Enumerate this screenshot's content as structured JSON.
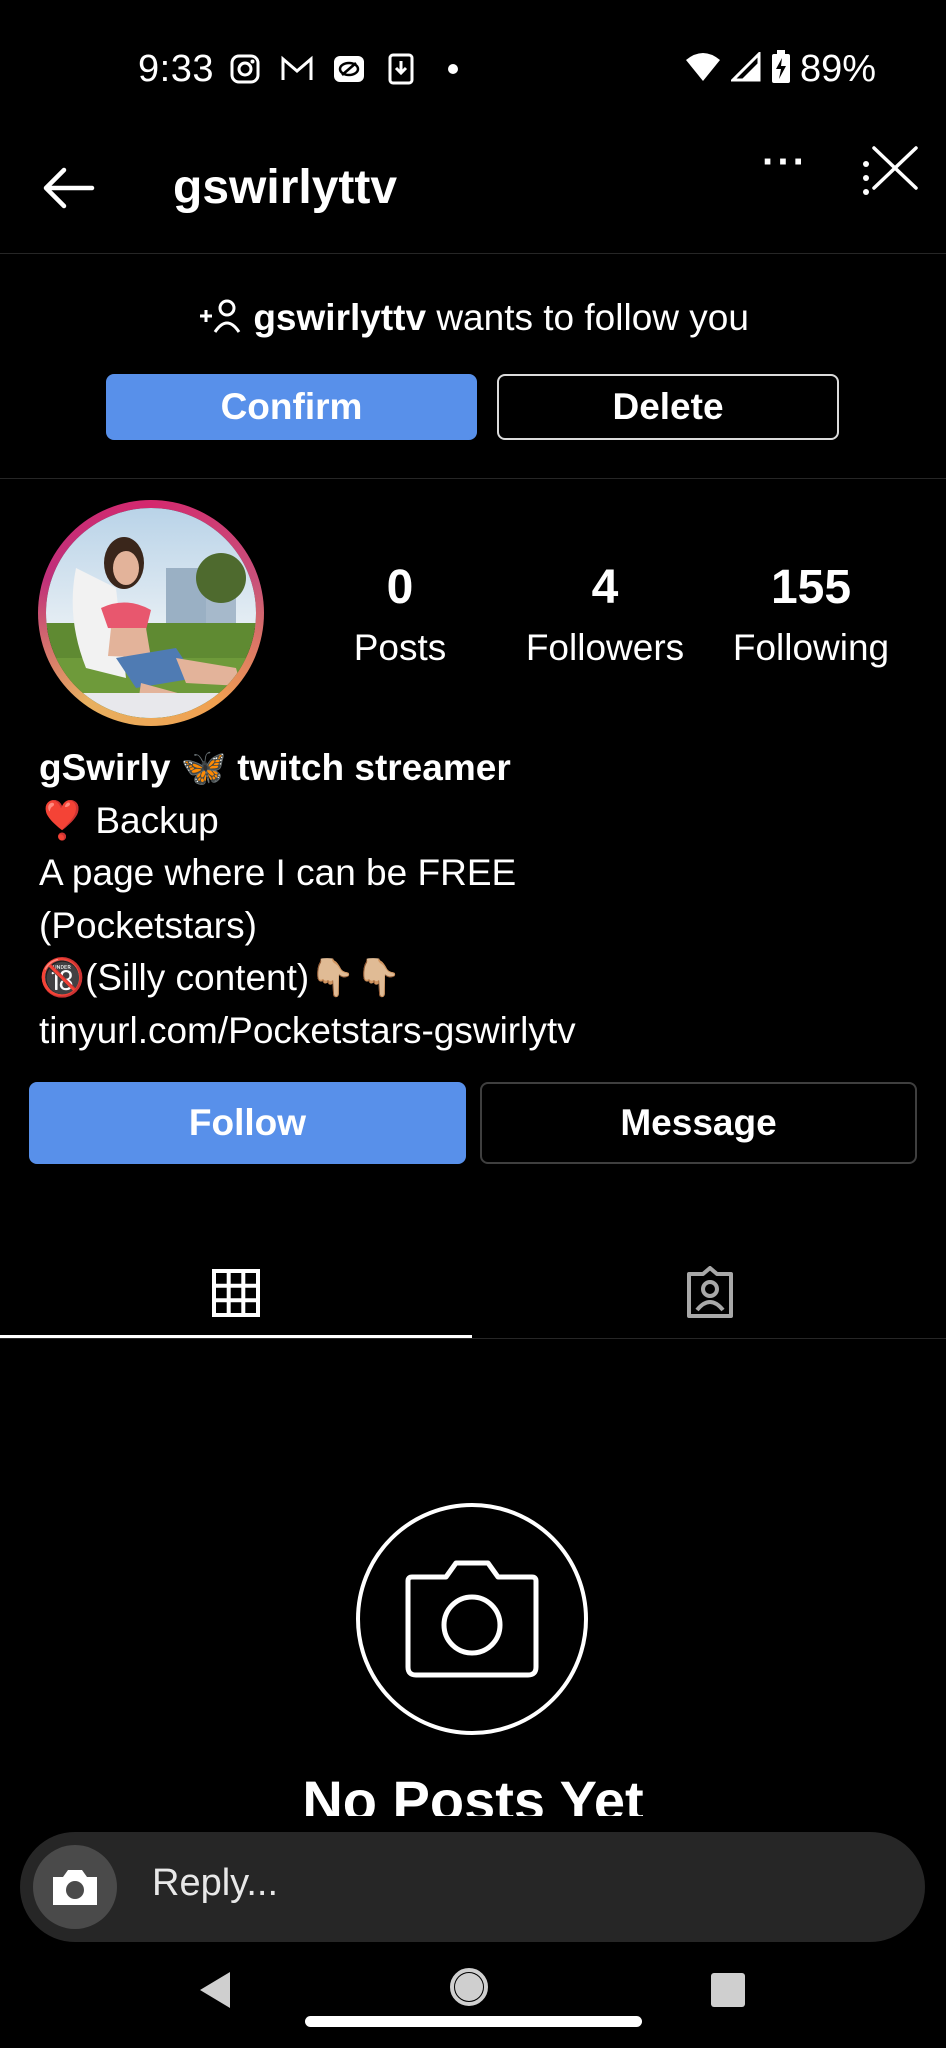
{
  "status_bar": {
    "time": "9:33",
    "battery": "89%",
    "icons": [
      "instagram-icon",
      "gmail-icon",
      "app-icon",
      "download-icon",
      "dot-icon",
      "wifi-icon",
      "signal-icon",
      "battery-icon"
    ]
  },
  "header": {
    "title": "gswirlyttv",
    "more_label": "···"
  },
  "follow_request": {
    "prefix_icon": "+person-icon",
    "username": "gswirlyttv",
    "text": " wants to follow you",
    "confirm_label": "Confirm",
    "delete_label": "Delete"
  },
  "profile": {
    "stats": [
      {
        "value": "0",
        "label": "Posts"
      },
      {
        "value": "4",
        "label": "Followers"
      },
      {
        "value": "155",
        "label": "Following"
      }
    ],
    "bio": {
      "name_line": "gSwirly 🦋 twitch streamer",
      "line2": "❣️ Backup",
      "line3": "A page where I can be FREE",
      "line4": " (Pocketstars)",
      "line5": "🔞(Silly content)👇🏼👇🏼",
      "link": "tinyurl.com/Pocketstars-gswirlytv"
    },
    "follow_label": "Follow",
    "message_label": "Message"
  },
  "tabs": [
    {
      "icon": "grid-icon",
      "active": true
    },
    {
      "icon": "tagged-person-icon",
      "active": false
    }
  ],
  "empty_state": {
    "title": "No Posts Yet"
  },
  "reply": {
    "placeholder": "Reply..."
  },
  "colors": {
    "accent": "#5890ea",
    "background": "#000000",
    "input_bg": "#262626"
  }
}
